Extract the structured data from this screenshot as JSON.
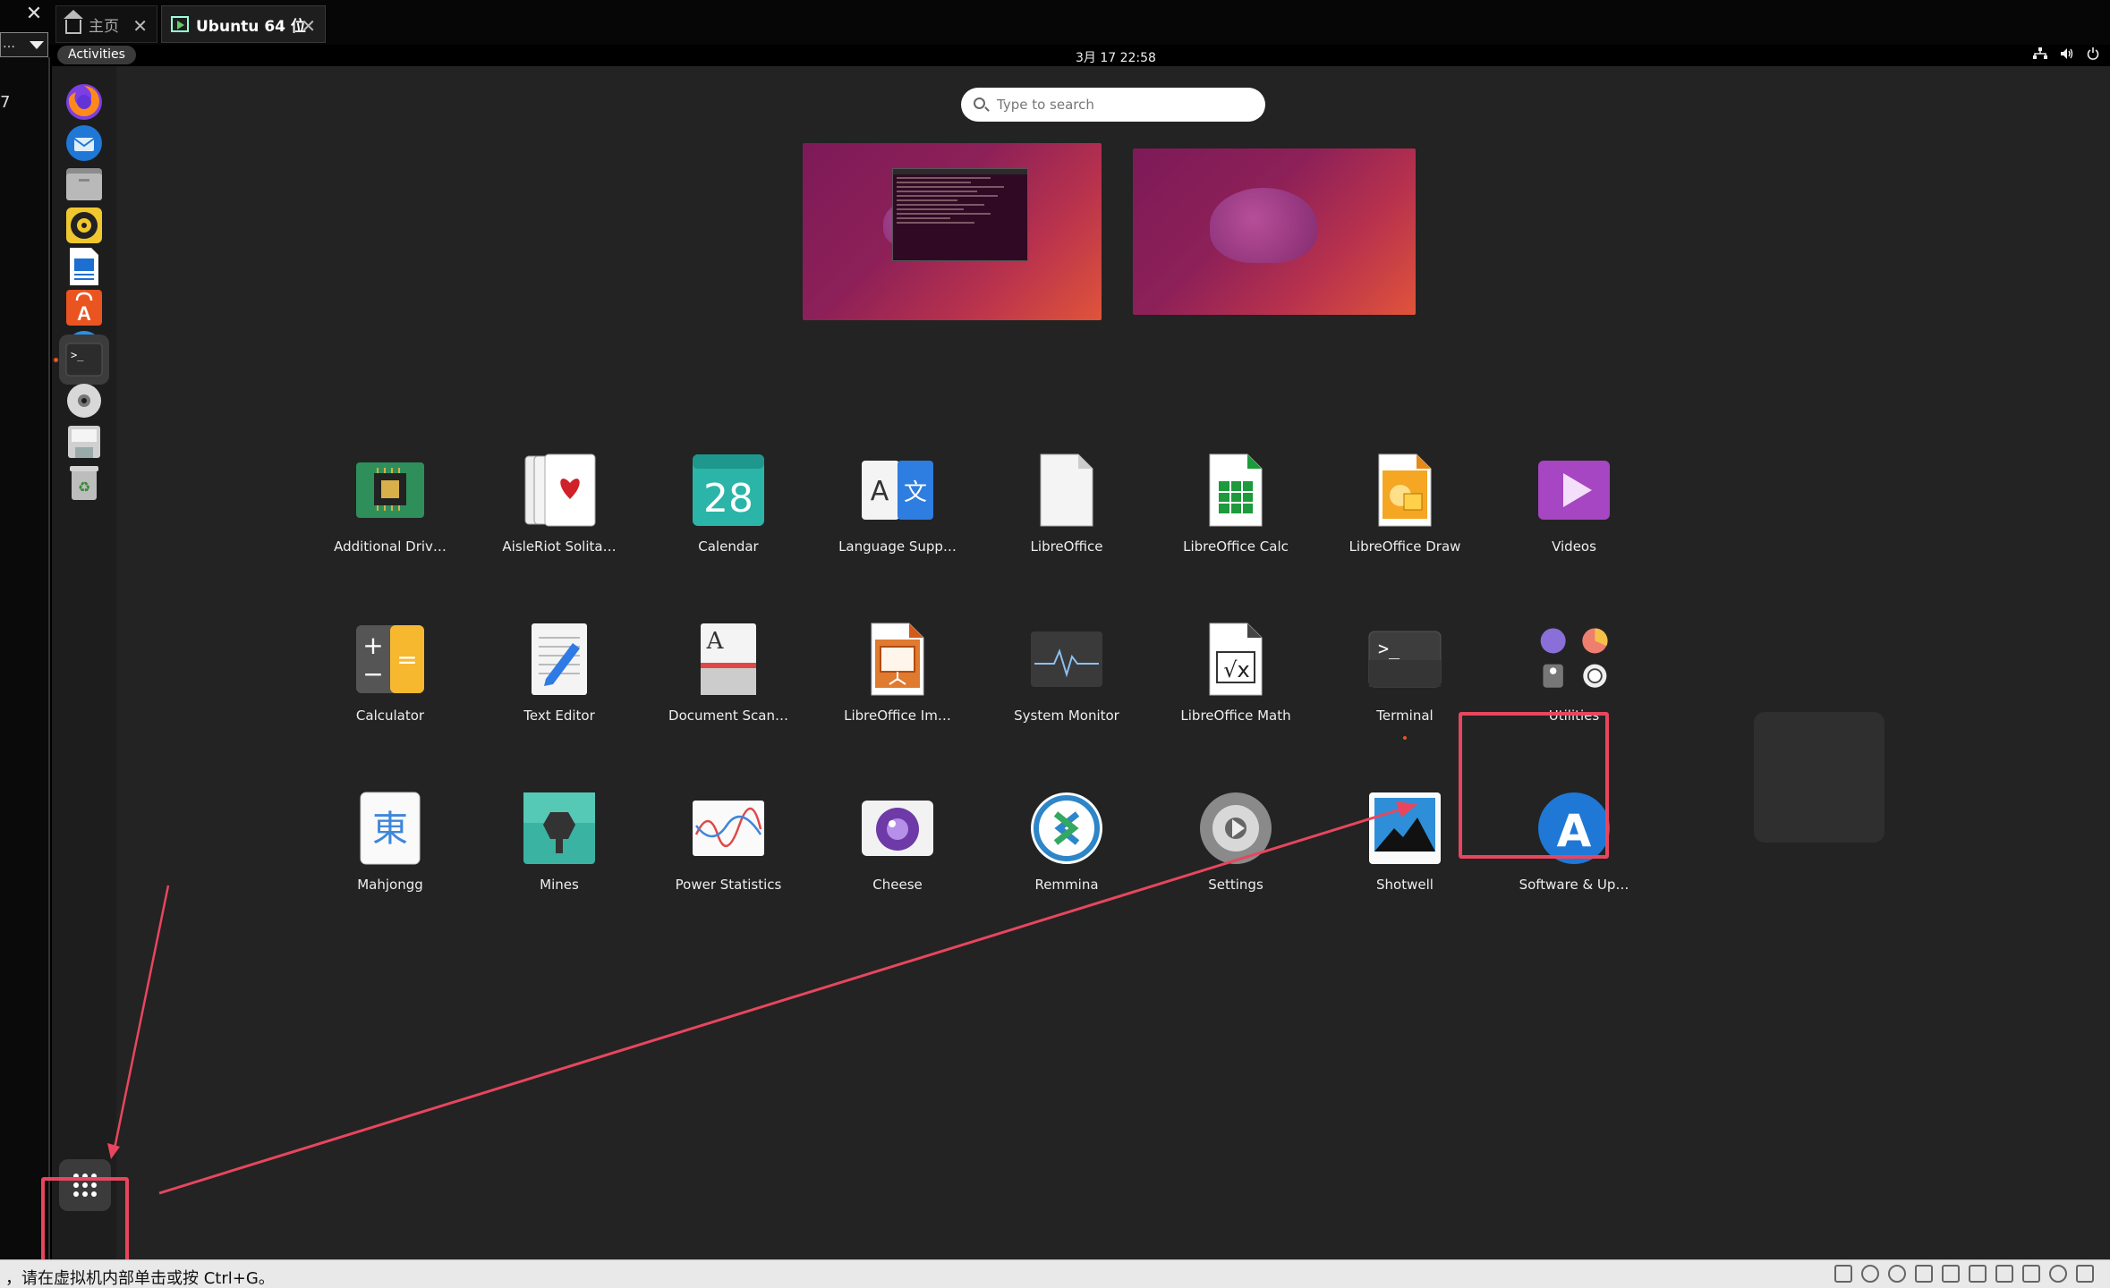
{
  "host": {
    "close_glyph": "✕",
    "dropdown_text": "…",
    "tabs": [
      {
        "label": "主页",
        "icon": "home-icon"
      },
      {
        "label": "Ubuntu 64 位",
        "icon": "vm-icon"
      }
    ],
    "side_mark": "7",
    "status_message": "，请在虚拟机内部单击或按 Ctrl+G。"
  },
  "topbar": {
    "activities": "Activities",
    "clock": "3月 17  22:58",
    "system_icons": [
      "network-icon",
      "volume-icon",
      "power-icon"
    ]
  },
  "dock": {
    "items": [
      {
        "name": "firefox-icon"
      },
      {
        "name": "thunderbird-icon"
      },
      {
        "name": "files-icon"
      },
      {
        "name": "rhythmbox-icon"
      },
      {
        "name": "libreoffice-writer-icon"
      },
      {
        "name": "app-center-icon"
      },
      {
        "name": "help-icon"
      },
      {
        "name": "terminal-icon",
        "active": true
      },
      {
        "name": "disc-icon"
      },
      {
        "name": "floppy-icon"
      },
      {
        "name": "trash-icon"
      }
    ],
    "show_apps": "show-apps-icon"
  },
  "search": {
    "placeholder": "Type to search"
  },
  "apps": [
    {
      "label": "Additional Driv…",
      "icon": "chip-icon"
    },
    {
      "label": "AisleRiot Solita…",
      "icon": "cards-icon"
    },
    {
      "label": "Calendar",
      "icon": "calendar-icon",
      "day": "28"
    },
    {
      "label": "Language Supp…",
      "icon": "language-icon"
    },
    {
      "label": "LibreOffice",
      "icon": "libreoffice-icon"
    },
    {
      "label": "LibreOffice Calc",
      "icon": "calc-icon"
    },
    {
      "label": "LibreOffice Draw",
      "icon": "draw-icon"
    },
    {
      "label": "Videos",
      "icon": "videos-icon"
    },
    {
      "label": "Calculator",
      "icon": "calculator-icon"
    },
    {
      "label": "Text Editor",
      "icon": "text-editor-icon"
    },
    {
      "label": "Document Scan…",
      "icon": "scanner-icon"
    },
    {
      "label": "LibreOffice Im…",
      "icon": "impress-icon"
    },
    {
      "label": "System Monitor",
      "icon": "system-monitor-icon"
    },
    {
      "label": "LibreOffice Math",
      "icon": "math-icon"
    },
    {
      "label": "Terminal",
      "icon": "terminal-icon"
    },
    {
      "label": "Utilities",
      "icon": "utilities-folder-icon"
    },
    {
      "label": "Mahjongg",
      "icon": "mahjongg-icon"
    },
    {
      "label": "Mines",
      "icon": "mines-icon"
    },
    {
      "label": "Power Statistics",
      "icon": "power-stats-icon"
    },
    {
      "label": "Cheese",
      "icon": "cheese-icon"
    },
    {
      "label": "Remmina",
      "icon": "remmina-icon"
    },
    {
      "label": "Settings",
      "icon": "settings-icon"
    },
    {
      "label": "Shotwell",
      "icon": "shotwell-icon"
    },
    {
      "label": "Software & Up…",
      "icon": "software-updates-icon"
    }
  ],
  "colors": {
    "accent": "#e95420",
    "annotation": "#e8465e"
  }
}
